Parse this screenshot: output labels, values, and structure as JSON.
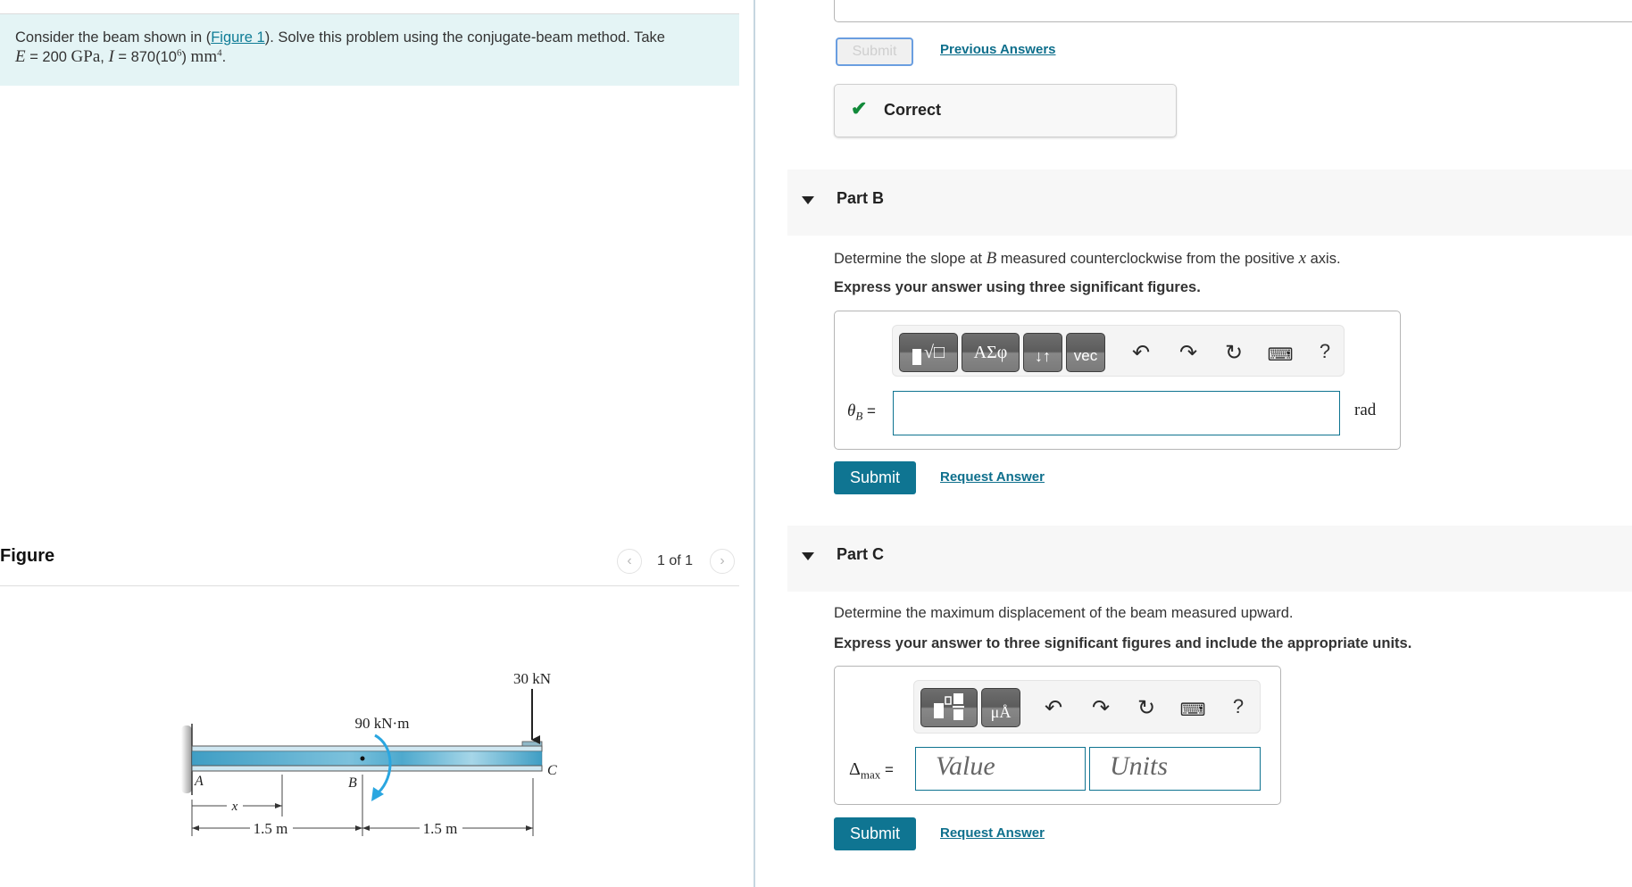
{
  "problem": {
    "text_before_link": "Consider the beam shown in (",
    "link_text": "Figure 1",
    "text_after_link": "). Solve this problem using the conjugate-beam method. Take",
    "line2": {
      "E_sym": "E",
      "E_val": " = 200 ",
      "E_unit": "GPa",
      "sep": ", ",
      "I_sym": "I",
      "I_val": " = 870(10",
      "I_exp": "6",
      "I_close": ") ",
      "I_unit": "mm",
      "I_unit_exp": "4",
      "end": "."
    }
  },
  "figure": {
    "title": "Figure",
    "pager": {
      "prev_icon": "chevron-left",
      "text": "1 of 1",
      "next_icon": "chevron-right"
    },
    "labels": {
      "point_a": "A",
      "point_b": "B",
      "point_c": "C",
      "moment": "90 kN·m",
      "force": "30 kN",
      "x_dim": "x",
      "dim_ab": "1.5 m",
      "dim_bc": "1.5 m"
    },
    "colors": {
      "beam": "#5fb3d3",
      "moment_arrow": "#2aa6e0"
    }
  },
  "part_a": {
    "submit_label": "Submit",
    "previous_answers_label": "Previous Answers",
    "feedback": {
      "icon": "check",
      "text": "Correct",
      "color": "#128a3a"
    }
  },
  "part_b": {
    "title": "Part B",
    "question_pre": "Determine the slope at ",
    "question_sym": "B",
    "question_mid": " measured counterclockwise from the positive ",
    "question_sym2": "x",
    "question_post": " axis.",
    "instruction": "Express your answer using three significant figures.",
    "toolbar": {
      "buttons": [
        {
          "name": "templates",
          "label": "√□"
        },
        {
          "name": "greek",
          "label": "ΑΣφ"
        },
        {
          "name": "arrows",
          "label": "↓↑"
        },
        {
          "name": "vector",
          "label": "vec"
        }
      ],
      "icons": [
        "undo",
        "redo",
        "reset",
        "keyboard",
        "help"
      ],
      "help_label": "?"
    },
    "variable_sym": "θ",
    "variable_sub": "B",
    "equals": "=",
    "input_value": "",
    "unit": "rad",
    "submit_label": "Submit",
    "request_label": "Request Answer"
  },
  "part_c": {
    "title": "Part C",
    "question": "Determine the maximum displacement of the beam measured upward.",
    "instruction": "Express your answer to three significant figures and include the appropriate units.",
    "toolbar": {
      "buttons": [
        {
          "name": "templates",
          "label": ""
        },
        {
          "name": "units",
          "label": "μÅ"
        }
      ],
      "icons": [
        "undo",
        "redo",
        "reset",
        "keyboard",
        "help"
      ],
      "help_label": "?"
    },
    "variable_sym": "Δ",
    "variable_sub": "max",
    "equals": "=",
    "value_placeholder": "Value",
    "units_placeholder": "Units",
    "submit_label": "Submit",
    "request_label": "Request Answer"
  }
}
